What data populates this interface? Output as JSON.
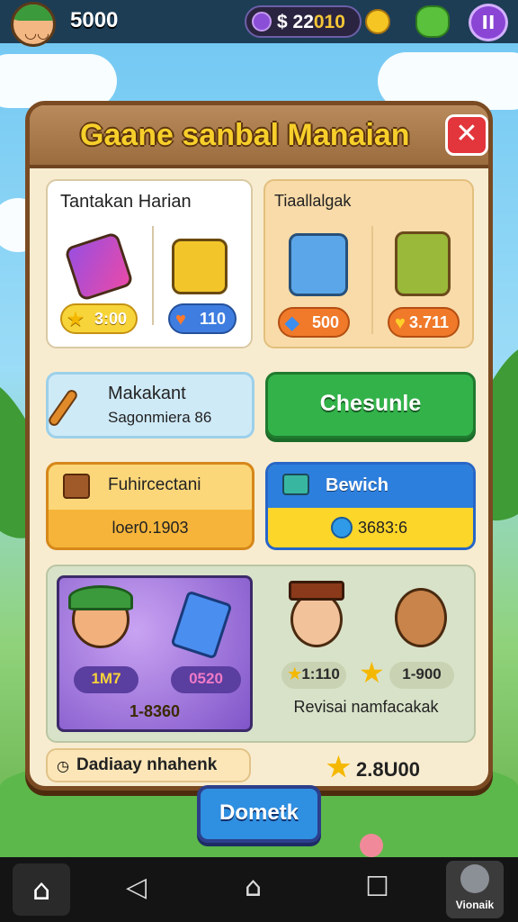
{
  "topbar": {
    "coins": "5000",
    "cash_prefix": "$ 22",
    "cash_suffix": "010",
    "pause_label": "II"
  },
  "dialog": {
    "title": "Gaane sanbal Manaian",
    "close_label": "✕"
  },
  "daily_left": {
    "title": "Tantakan Harian",
    "items": [
      {
        "icon": "gift-icon",
        "price": "3:00",
        "price_icon": "star-icon"
      },
      {
        "icon": "chest-icon",
        "price": "110",
        "price_icon": "heart-icon"
      }
    ]
  },
  "daily_right": {
    "title": "Tiaallalgak",
    "items": [
      {
        "icon": "backpack-icon",
        "price": "500",
        "price_icon": "gem-icon"
      },
      {
        "icon": "bag-icon",
        "price": "3.711",
        "price_icon": "heart-icon"
      }
    ]
  },
  "search_card": {
    "title": "Makakant",
    "subtitle": "Sagonmiera 86"
  },
  "check_button": {
    "label": "Chesunle"
  },
  "fund_card": {
    "title": "Fuhircectani",
    "value": "loer0.1903"
  },
  "bew_card": {
    "title": "Bewich",
    "value": "3683:6"
  },
  "characters": {
    "left": {
      "stat_a": "1M7",
      "stat_b": "0520",
      "total": "1-8360"
    },
    "right": {
      "stat_a": "1:110",
      "stat_b": "1-900",
      "caption": "Revisai namfacakak"
    }
  },
  "footer": {
    "left_label": "Dadiaay nhahenk",
    "right_value": "2.8U00"
  },
  "bottom_button": {
    "label": "Dometk"
  },
  "navbar": {
    "app_label": "Vionaik"
  },
  "colors": {
    "panel_bg": "#f8ecd0",
    "panel_border": "#7a4b22",
    "title_gold": "#f7cf2b",
    "close_red": "#e2363c",
    "check_green": "#33b24a",
    "bottom_blue": "#2f8fe0"
  }
}
